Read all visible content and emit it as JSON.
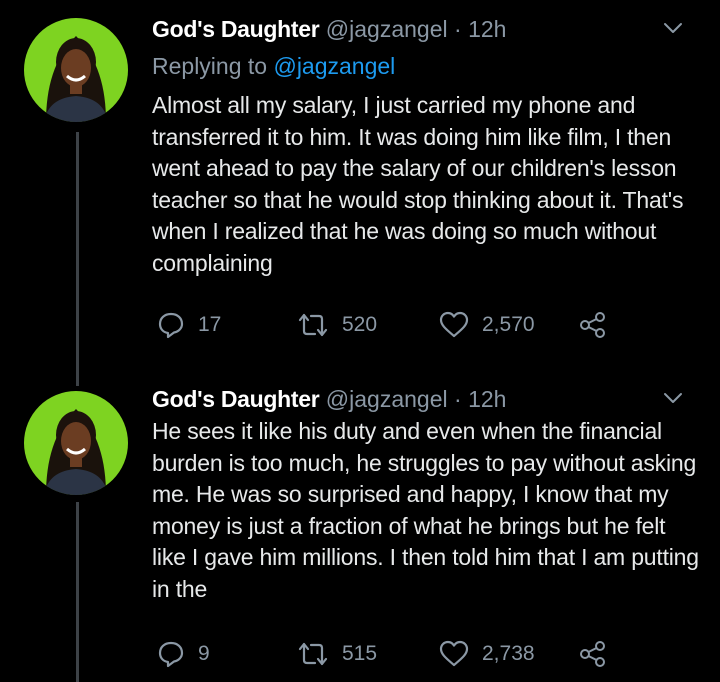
{
  "colors": {
    "background": "#000000",
    "text": "#e7e9ea",
    "secondary_text": "#8b98a5",
    "link": "#1d9bf0",
    "avatar_background": "#7ed321",
    "thread_line": "#3d4247"
  },
  "tweets": [
    {
      "display_name": "God's Daughter",
      "handle": "@jagzangel",
      "separator": "·",
      "time": "12h",
      "replying_prefix": "Replying to ",
      "replying_to": "@jagzangel",
      "text": "Almost all my salary,  I just carried my phone and transferred it to him. It was doing him like film, I then went ahead to pay the salary of our children's lesson teacher so that he would stop thinking about it. That's when I realized that he was doing so much without complaining",
      "replies": "17",
      "retweets": "520",
      "likes": "2,570",
      "icons": [
        "chevron-down-icon",
        "reply-icon",
        "retweet-icon",
        "heart-icon",
        "share-icon"
      ]
    },
    {
      "display_name": "God's Daughter",
      "handle": "@jagzangel",
      "separator": "·",
      "time": "12h",
      "text": "He sees it like his duty and even when the financial burden is too much, he struggles to pay without asking me. He was so surprised and happy, I know that my money is just a fraction of what he brings but he felt like I gave him millions. I then told him that I am putting in the",
      "replies": "9",
      "retweets": "515",
      "likes": "2,738",
      "icons": [
        "chevron-down-icon",
        "reply-icon",
        "retweet-icon",
        "heart-icon",
        "share-icon"
      ]
    }
  ]
}
